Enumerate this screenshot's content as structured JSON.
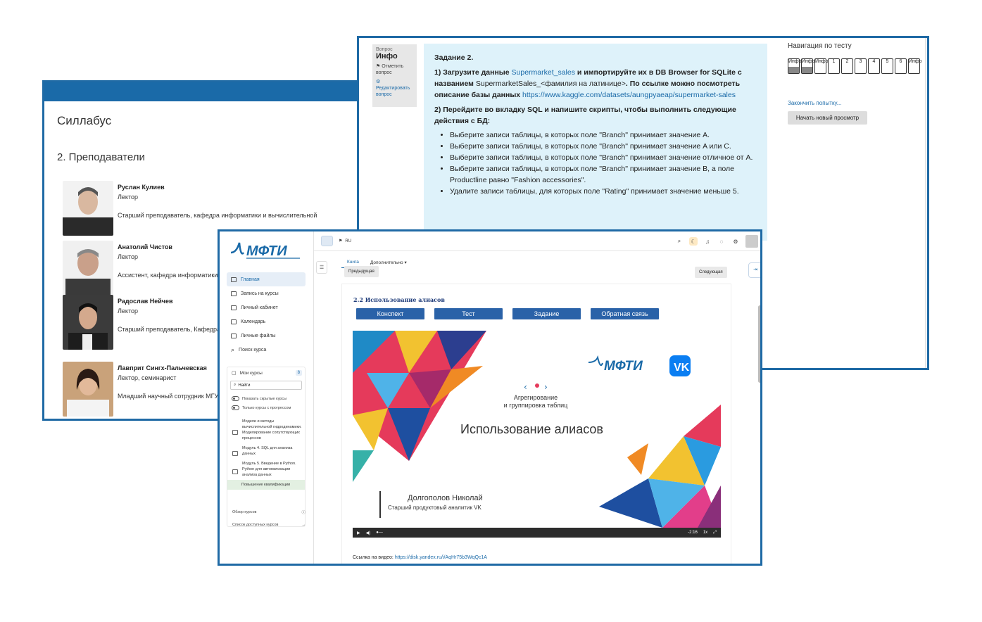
{
  "syllabus": {
    "title": "Силлабус",
    "section": "2. Преподаватели",
    "teachers": [
      {
        "name": "Руслан Кулиев",
        "role": "Лектор",
        "desc": "Старший преподаватель, кафедра информатики и вычислительной"
      },
      {
        "name": "Анатолий Чистов",
        "role": "Лектор",
        "desc": "Ассистент, кафедра информатики"
      },
      {
        "name": "Радослав Нейчев",
        "role": "Лектор",
        "desc": "Старший преподаватель, Кафедра"
      },
      {
        "name": "Лавприт Сингх-Пальчевская",
        "role": "Лектор, семинарист",
        "desc": "Младший научный сотрудник МГУ"
      }
    ]
  },
  "quiz": {
    "info": {
      "small": "Вопрос",
      "big": "Инфо",
      "flag": "Отметить вопрос",
      "edit": "Редактировать вопрос"
    },
    "task_title": "Задание 2.",
    "p1_a": "1) Загрузите данные ",
    "p1_link1": "Supermarket_sales",
    "p1_b": " и импортируйте их в DB Browser for SQLite с названием ",
    "p1_plain": "SupermarketSales_<фамилия на латинице>",
    "p1_c": ". По ссылке можно посмотреть описание базы данных ",
    "p1_link2": "https://www.kaggle.com/datasets/aungpyaeap/supermarket-sales",
    "p2": "2) Перейдите во вкладку SQL и напишите скрипты, чтобы выполнить следующие действия с БД:",
    "bullets": [
      "Выберите записи таблицы, в которых поле \"Branch\" принимает значение A.",
      "Выберите записи таблицы, в которых поле \"Branch\" принимает значение A или C.",
      "Выберите записи таблицы, в которых поле \"Branch\" принимает значение отличное от A.",
      "Выберите записи таблицы, в которых поле \"Branch\" принимает значение B, а поле Productline равно \"Fashion accessories\".",
      "Удалите записи таблицы, для которых поле \"Rating\" принимает значение меньше 5."
    ],
    "nav": {
      "title": "Навигация по тесту",
      "cells": [
        "Инфо",
        "Инфо",
        "Инфо",
        "1",
        "2",
        "3",
        "4",
        "5",
        "6",
        "Инфо"
      ],
      "finish": "Закончить попытку...",
      "new_view": "Начать новый просмотр"
    }
  },
  "lms": {
    "logo": "МФТИ",
    "menu": [
      "Главная",
      "Запись на курсы",
      "Личный кабинет",
      "Календарь",
      "Личные файлы",
      "Поиск курса"
    ],
    "my_courses": "Мои курсы",
    "my_courses_count": "8",
    "find": "Найти",
    "toggle1": "Показать скрытые курсы",
    "toggle2": "Только курсы с прогрессом",
    "courses": [
      "Модели и методы вычислительной гидродинамики. Моделирование сопутствующих процессов",
      "Модуль 4. SQL для анализа данных",
      "Модуль 5. Введение в Python. Python для автоматизации анализа данных",
      "Повышение квалификации"
    ],
    "bottom1": "Обзор курсов",
    "bottom2": "Список доступных курсов",
    "lang": "RU",
    "tabs": [
      "Книга",
      "Дополнительно ▾"
    ],
    "prev": "Предыдущая",
    "next": "Следующая",
    "lesson_title": "2.2 Использование алиасов",
    "buttons": [
      "Конспект",
      "Тест",
      "Задание",
      "Обратная связь"
    ],
    "video": {
      "topic1": "Агрегирование",
      "topic2": "и группировка таблиц",
      "title": "Использование алиасов",
      "author": "Долгополов Николай",
      "author_role": "Старший продуктовый аналитик VK",
      "logo": "МФТИ",
      "time": "-2:16",
      "speed": "1x"
    },
    "video_link_label": "Ссылка на видео: ",
    "video_link": "https://disk.yandex.ru/i/AqHr75b3WqQc1A"
  },
  "colors": {
    "accent": "#1a6aa8",
    "button": "#2a62a8",
    "quiz_bg": "#def2fa"
  }
}
